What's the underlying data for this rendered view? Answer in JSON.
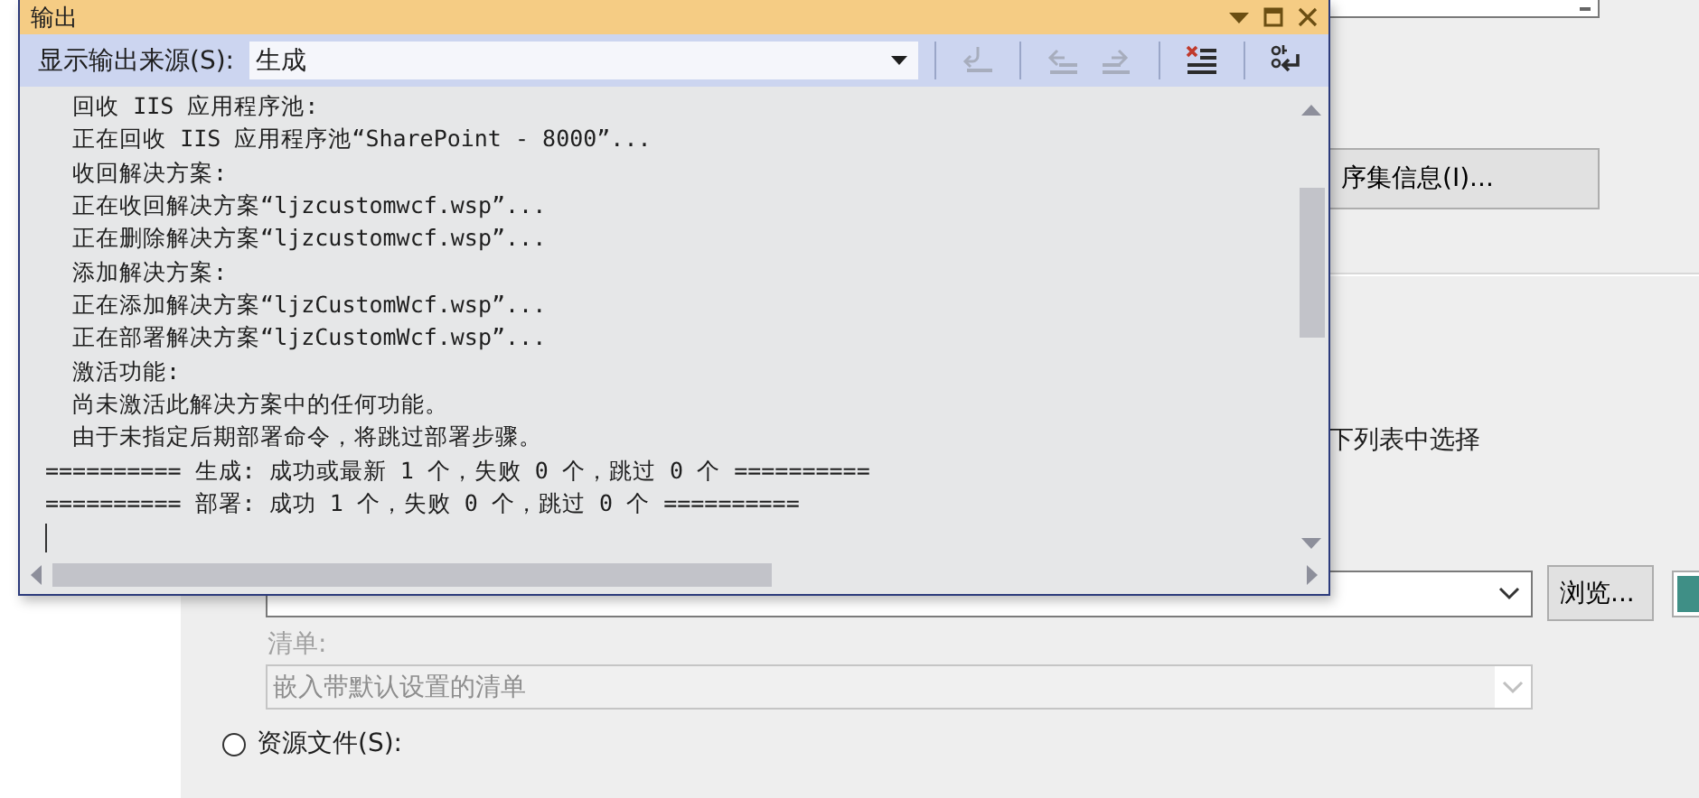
{
  "properties_page": {
    "assembly_info_button": "序集信息(I)...",
    "list_hint": "下列表中选择",
    "browse_button": "浏览...",
    "manifest_label": "清单:",
    "manifest_combo": {
      "value": "嵌入带默认设置的清单",
      "disabled": true
    },
    "resource_radio": {
      "label": "资源文件(S):",
      "selected": false
    }
  },
  "output_window": {
    "title": "输出",
    "source_label": "显示输出来源(S):",
    "source_value": "生成",
    "toolbar": [
      {
        "kind": "goto",
        "disabled": true
      },
      {
        "kind": "prev",
        "disabled": true
      },
      {
        "kind": "next",
        "disabled": true
      },
      {
        "kind": "clear",
        "disabled": false
      },
      {
        "kind": "wrap",
        "disabled": false
      }
    ],
    "lines": [
      "  回收 IIS 应用程序池:",
      "  正在回收 IIS 应用程序池“SharePoint - 8000”...",
      "  收回解决方案:",
      "  正在收回解决方案“ljzcustomwcf.wsp”...",
      "  正在删除解决方案“ljzcustomwcf.wsp”...",
      "  添加解决方案:",
      "  正在添加解决方案“ljzCustomWcf.wsp”...",
      "  正在部署解决方案“ljzCustomWcf.wsp”...",
      "  激活功能:",
      "  尚未激活此解决方案中的任何功能。",
      "  由于未指定后期部署命令，将跳过部署步骤。",
      "========== 生成: 成功或最新 1 个，失败 0 个，跳过 0 个 ==========",
      "========== 部署: 成功 1 个，失败 0 个，跳过 0 个 =========="
    ]
  }
}
